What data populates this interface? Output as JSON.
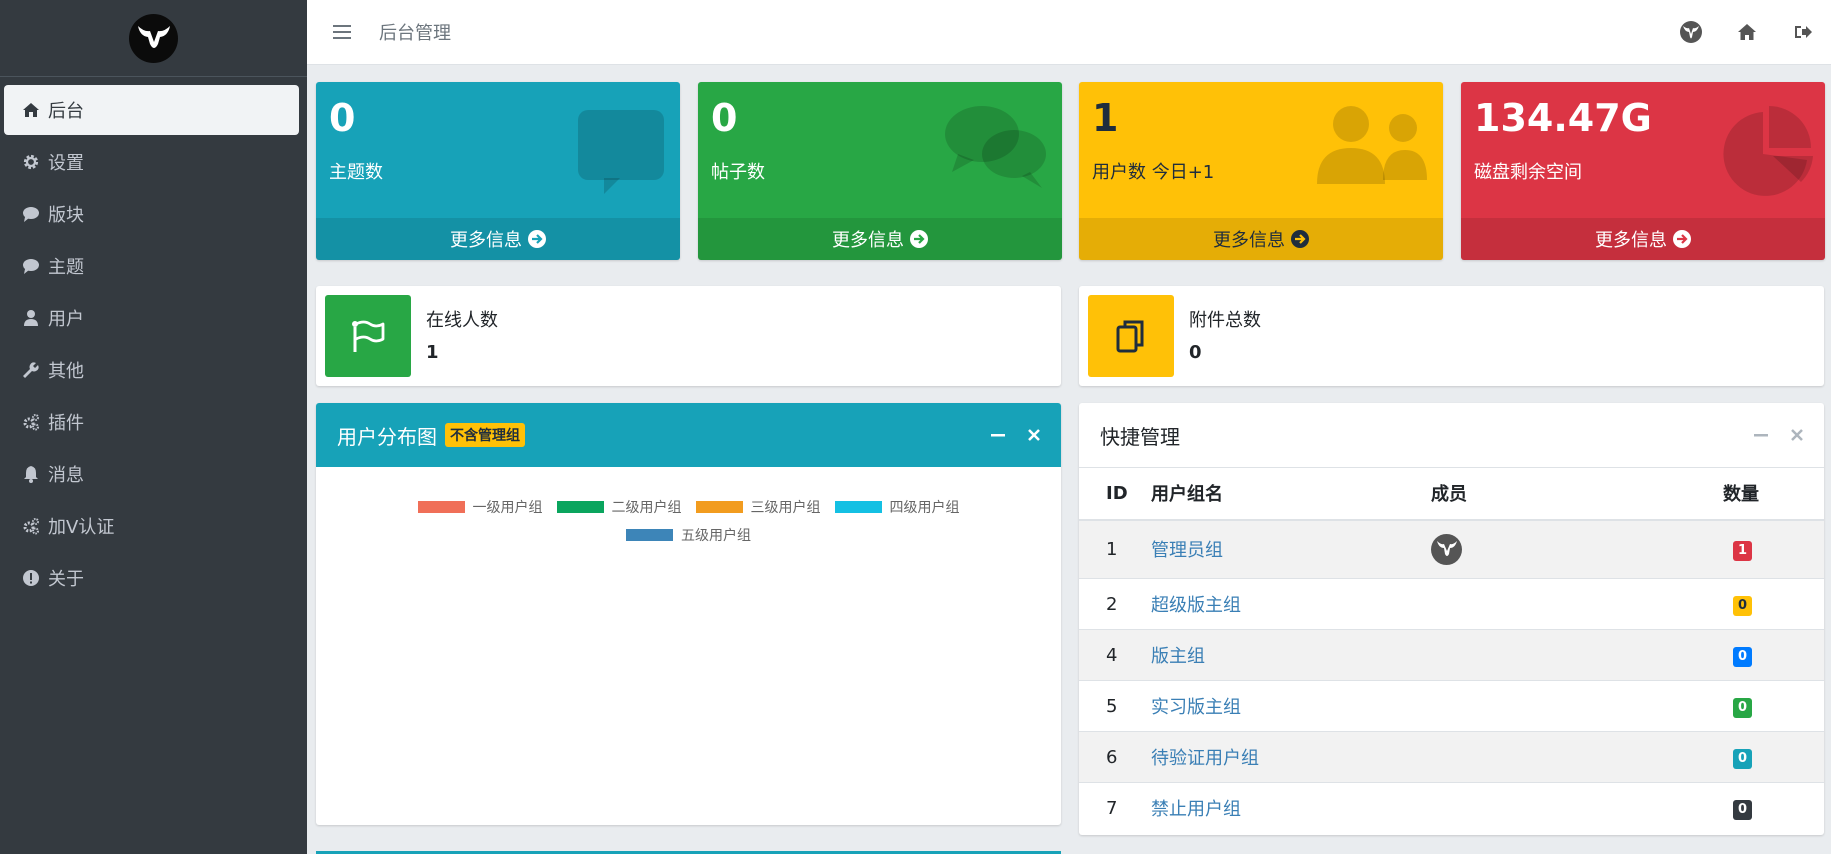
{
  "sidebar": {
    "items": [
      {
        "label": "后台",
        "icon": "home-icon"
      },
      {
        "label": "设置",
        "icon": "gear-icon"
      },
      {
        "label": "版块",
        "icon": "comment-icon"
      },
      {
        "label": "主题",
        "icon": "comment-icon"
      },
      {
        "label": "用户",
        "icon": "user-icon"
      },
      {
        "label": "其他",
        "icon": "wrench-icon"
      },
      {
        "label": "插件",
        "icon": "gears-icon"
      },
      {
        "label": "消息",
        "icon": "bell-icon"
      },
      {
        "label": "加V认证",
        "icon": "gears-icon"
      },
      {
        "label": "关于",
        "icon": "info-circle-icon"
      }
    ]
  },
  "header": {
    "breadcrumb": "后台管理"
  },
  "stats": [
    {
      "value": "0",
      "label": "主题数",
      "footer": "更多信息",
      "color": "#17a2b8",
      "icon": "comment-icon"
    },
    {
      "value": "0",
      "label": "帖子数",
      "footer": "更多信息",
      "color": "#28a745",
      "icon": "comments-icon"
    },
    {
      "value": "1",
      "label": "用户数 今日+1",
      "footer": "更多信息",
      "color": "#ffc107",
      "icon": "users-icon"
    },
    {
      "value": "134.47G",
      "label": "磁盘剩余空间",
      "footer": "更多信息",
      "color": "#dc3545",
      "icon": "pie-chart-icon"
    }
  ],
  "info": {
    "online": {
      "title": "在线人数",
      "value": "1",
      "color": "#28a745",
      "icon": "flag-icon"
    },
    "attachments": {
      "title": "附件总数",
      "value": "0",
      "color": "#ffc107",
      "icon": "copy-icon"
    }
  },
  "chart_card": {
    "title": "用户分布图",
    "badge": "不含管理组"
  },
  "chart_data": {
    "type": "pie",
    "title": "",
    "legend_position": "top",
    "series": [
      {
        "name": "一级用户组",
        "color": "#f06f58"
      },
      {
        "name": "二级用户组",
        "color": "#0aa55e"
      },
      {
        "name": "三级用户组",
        "color": "#f29c1f"
      },
      {
        "name": "四级用户组",
        "color": "#14c0e3"
      },
      {
        "name": "五级用户组",
        "color": "#3d85b8"
      }
    ]
  },
  "quick": {
    "title": "快捷管理",
    "columns": [
      "ID",
      "用户组名",
      "成员",
      "数量"
    ],
    "rows": [
      {
        "id": "1",
        "name": "管理员组",
        "member": "avatar",
        "count": "1",
        "color": "#dc3545"
      },
      {
        "id": "2",
        "name": "超级版主组",
        "member": "",
        "count": "0",
        "color": "#ffc107"
      },
      {
        "id": "4",
        "name": "版主组",
        "member": "",
        "count": "0",
        "color": "#007bff"
      },
      {
        "id": "5",
        "name": "实习版主组",
        "member": "",
        "count": "0",
        "color": "#28a745"
      },
      {
        "id": "6",
        "name": "待验证用户组",
        "member": "",
        "count": "0",
        "color": "#17a2b8"
      },
      {
        "id": "7",
        "name": "禁止用户组",
        "member": "",
        "count": "0",
        "color": "#343a40"
      }
    ]
  }
}
